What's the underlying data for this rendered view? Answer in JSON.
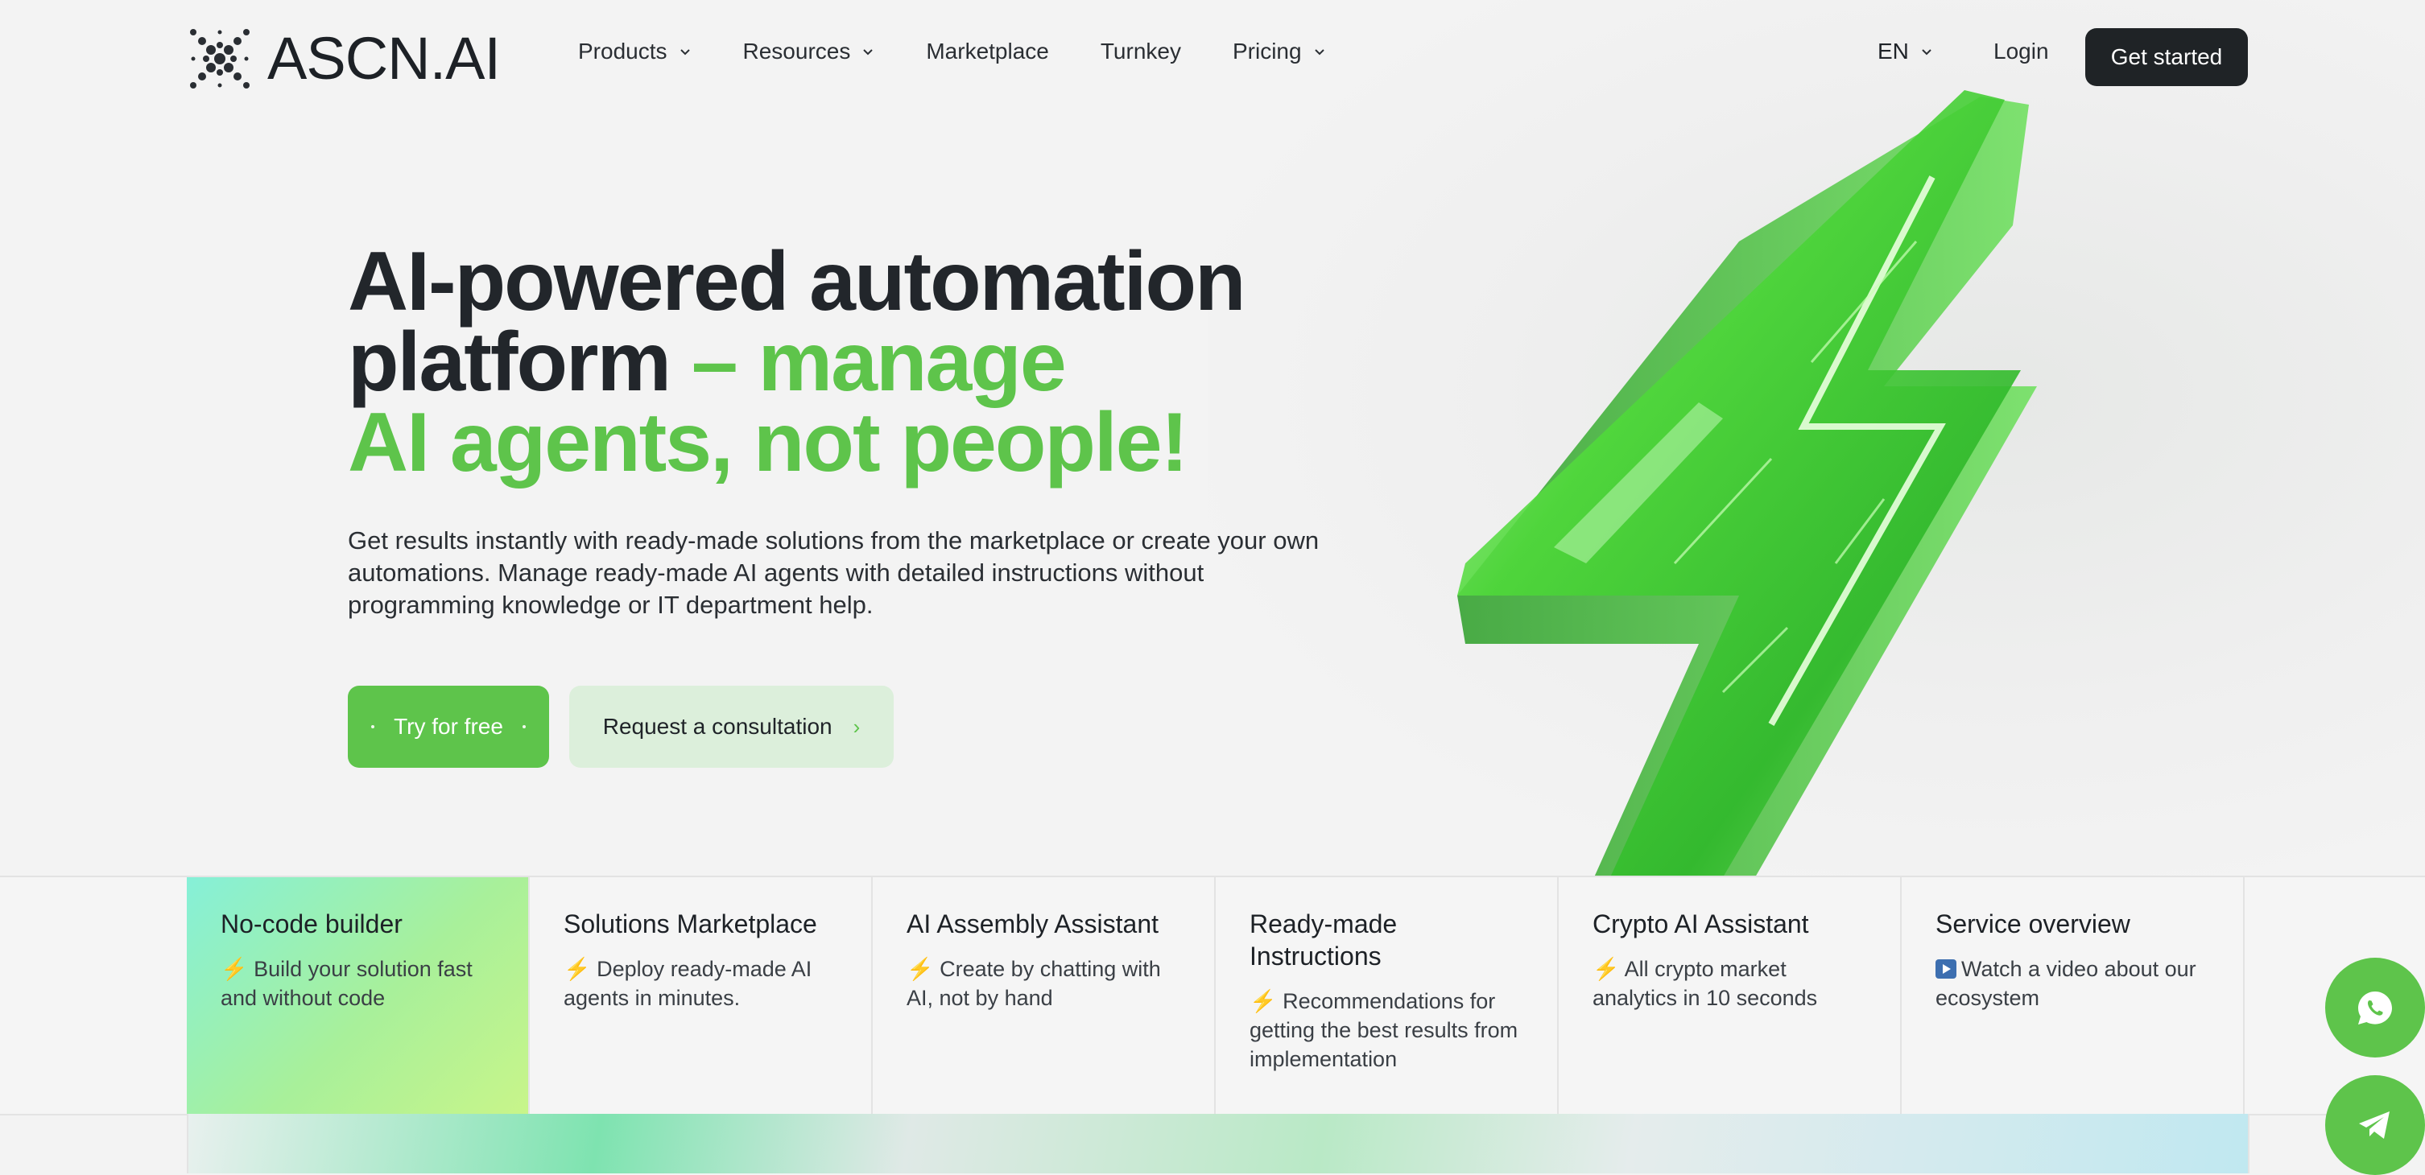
{
  "header": {
    "logo_text": "ASCN.AI",
    "nav": [
      {
        "label": "Products",
        "has_dropdown": true
      },
      {
        "label": "Resources",
        "has_dropdown": true
      },
      {
        "label": "Marketplace",
        "has_dropdown": false
      },
      {
        "label": "Turnkey",
        "has_dropdown": false
      },
      {
        "label": "Pricing",
        "has_dropdown": true
      }
    ],
    "language": "EN",
    "login_label": "Login",
    "get_started_label": "Get started"
  },
  "hero": {
    "title_dark": "AI-powered automation platform",
    "title_green_1": " – manage",
    "title_green_2": "AI agents, not people!",
    "subtitle": "Get results instantly with ready-made solutions from the marketplace or create your own automations. Manage ready-made AI agents with detailed instructions without programming knowledge or IT department help.",
    "try_label": "Try for free",
    "consult_label": "Request a consultation",
    "consult_arrow": "›"
  },
  "features": [
    {
      "title": "No-code builder",
      "icon": "⚡",
      "desc": "Build your solution fast and without code",
      "active": true
    },
    {
      "title": "Solutions Marketplace",
      "icon": "⚡",
      "desc": "Deploy ready-made AI agents in minutes.",
      "active": false
    },
    {
      "title": "AI Assembly Assistant",
      "icon": "⚡",
      "desc": "Create by chatting with AI, not by hand",
      "active": false
    },
    {
      "title": "Ready-made Instructions",
      "icon": "⚡",
      "desc": "Recommendations for getting the best results from implementation",
      "active": false
    },
    {
      "title": "Crypto AI Assistant",
      "icon": "⚡",
      "desc": "All crypto market analytics in 10 seconds",
      "active": false
    },
    {
      "title": "Service overview",
      "icon": "video-icon",
      "desc": "Watch a video about our ecosystem",
      "active": false
    }
  ],
  "colors": {
    "brand_green": "#5ec44b",
    "dark_button": "#1f2326",
    "consult_bg": "#dcefdb"
  },
  "floating": [
    "whatsapp-icon",
    "telegram-icon"
  ]
}
